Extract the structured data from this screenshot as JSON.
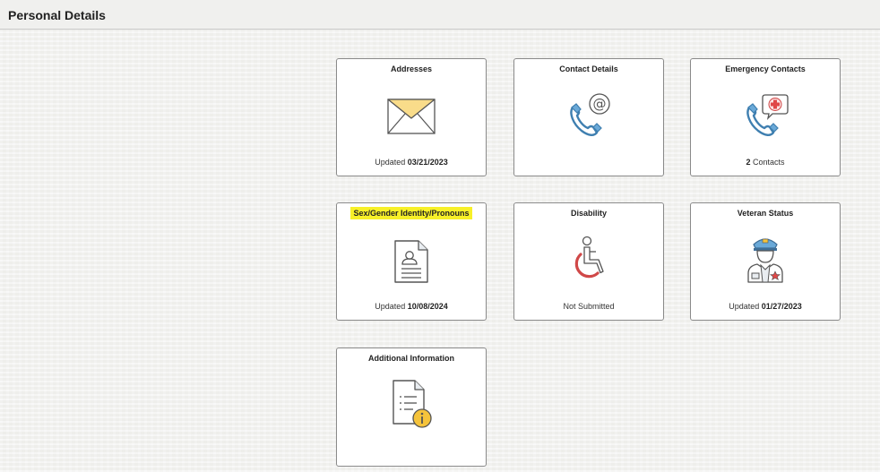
{
  "page": {
    "title": "Personal Details"
  },
  "tiles": [
    {
      "title": "Addresses",
      "icon": "envelope-icon",
      "footer_prefix": "Updated",
      "footer_value": "03/21/2023"
    },
    {
      "title": "Contact Details",
      "icon": "phone-at-icon",
      "footer_prefix": "",
      "footer_value": ""
    },
    {
      "title": "Emergency Contacts",
      "icon": "phone-medical-icon",
      "footer_prefix": "Contacts",
      "footer_value": "2"
    },
    {
      "title": "Sex/Gender Identity/Pronouns",
      "icon": "id-document-icon",
      "footer_prefix": "Updated",
      "footer_value": "10/08/2024",
      "highlighted": true
    },
    {
      "title": "Disability",
      "icon": "wheelchair-icon",
      "footer_prefix": "Not Submitted",
      "footer_value": ""
    },
    {
      "title": "Veteran Status",
      "icon": "veteran-icon",
      "footer_prefix": "Updated",
      "footer_value": "01/27/2023"
    },
    {
      "title": "Additional Information",
      "icon": "document-info-icon",
      "footer_prefix": "",
      "footer_value": ""
    }
  ],
  "colors": {
    "highlight": "#f7f028",
    "envelope_fill": "#f9dc8a",
    "phone_blue": "#6aa9d8",
    "medical_red": "#e04848",
    "info_orange": "#f5c33b"
  }
}
